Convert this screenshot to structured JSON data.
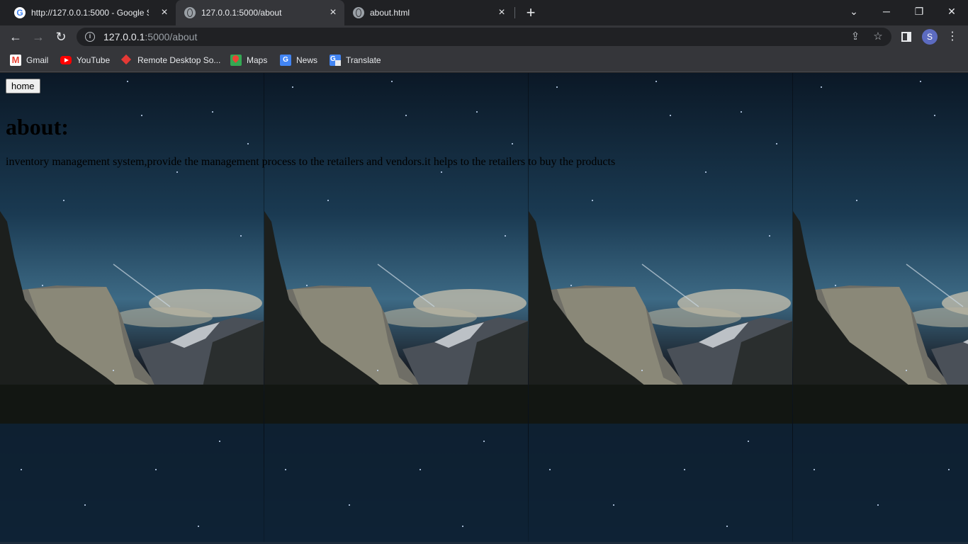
{
  "browser": {
    "tabs": [
      {
        "title": "http://127.0.0.1:5000 - Google Se",
        "favicon": "google-icon",
        "active": false
      },
      {
        "title": "127.0.0.1:5000/about",
        "favicon": "globe-icon",
        "active": true
      },
      {
        "title": "about.html",
        "favicon": "globe-icon",
        "active": false
      }
    ],
    "new_tab_label": "+",
    "address": {
      "host": "127.0.0.1",
      "path": ":5000/about"
    },
    "profile_initial": "S",
    "bookmarks": [
      {
        "label": "Gmail",
        "icon": "gmail-icon"
      },
      {
        "label": "YouTube",
        "icon": "youtube-icon"
      },
      {
        "label": "Remote Desktop So...",
        "icon": "remote-desktop-icon"
      },
      {
        "label": "Maps",
        "icon": "maps-icon"
      },
      {
        "label": "News",
        "icon": "news-icon"
      },
      {
        "label": "Translate",
        "icon": "translate-icon"
      }
    ]
  },
  "page": {
    "home_button": "home",
    "heading": "about:",
    "description": "inventory management system,provide the management process to the retailers and vendors.it helps to the retailers to buy the products",
    "background": "tiled night-sky mountain photo"
  },
  "colors": {
    "chrome_dark": "#202124",
    "chrome_toolbar": "#35363a",
    "avatar": "#5c6bc0",
    "page_text": "#000000"
  }
}
